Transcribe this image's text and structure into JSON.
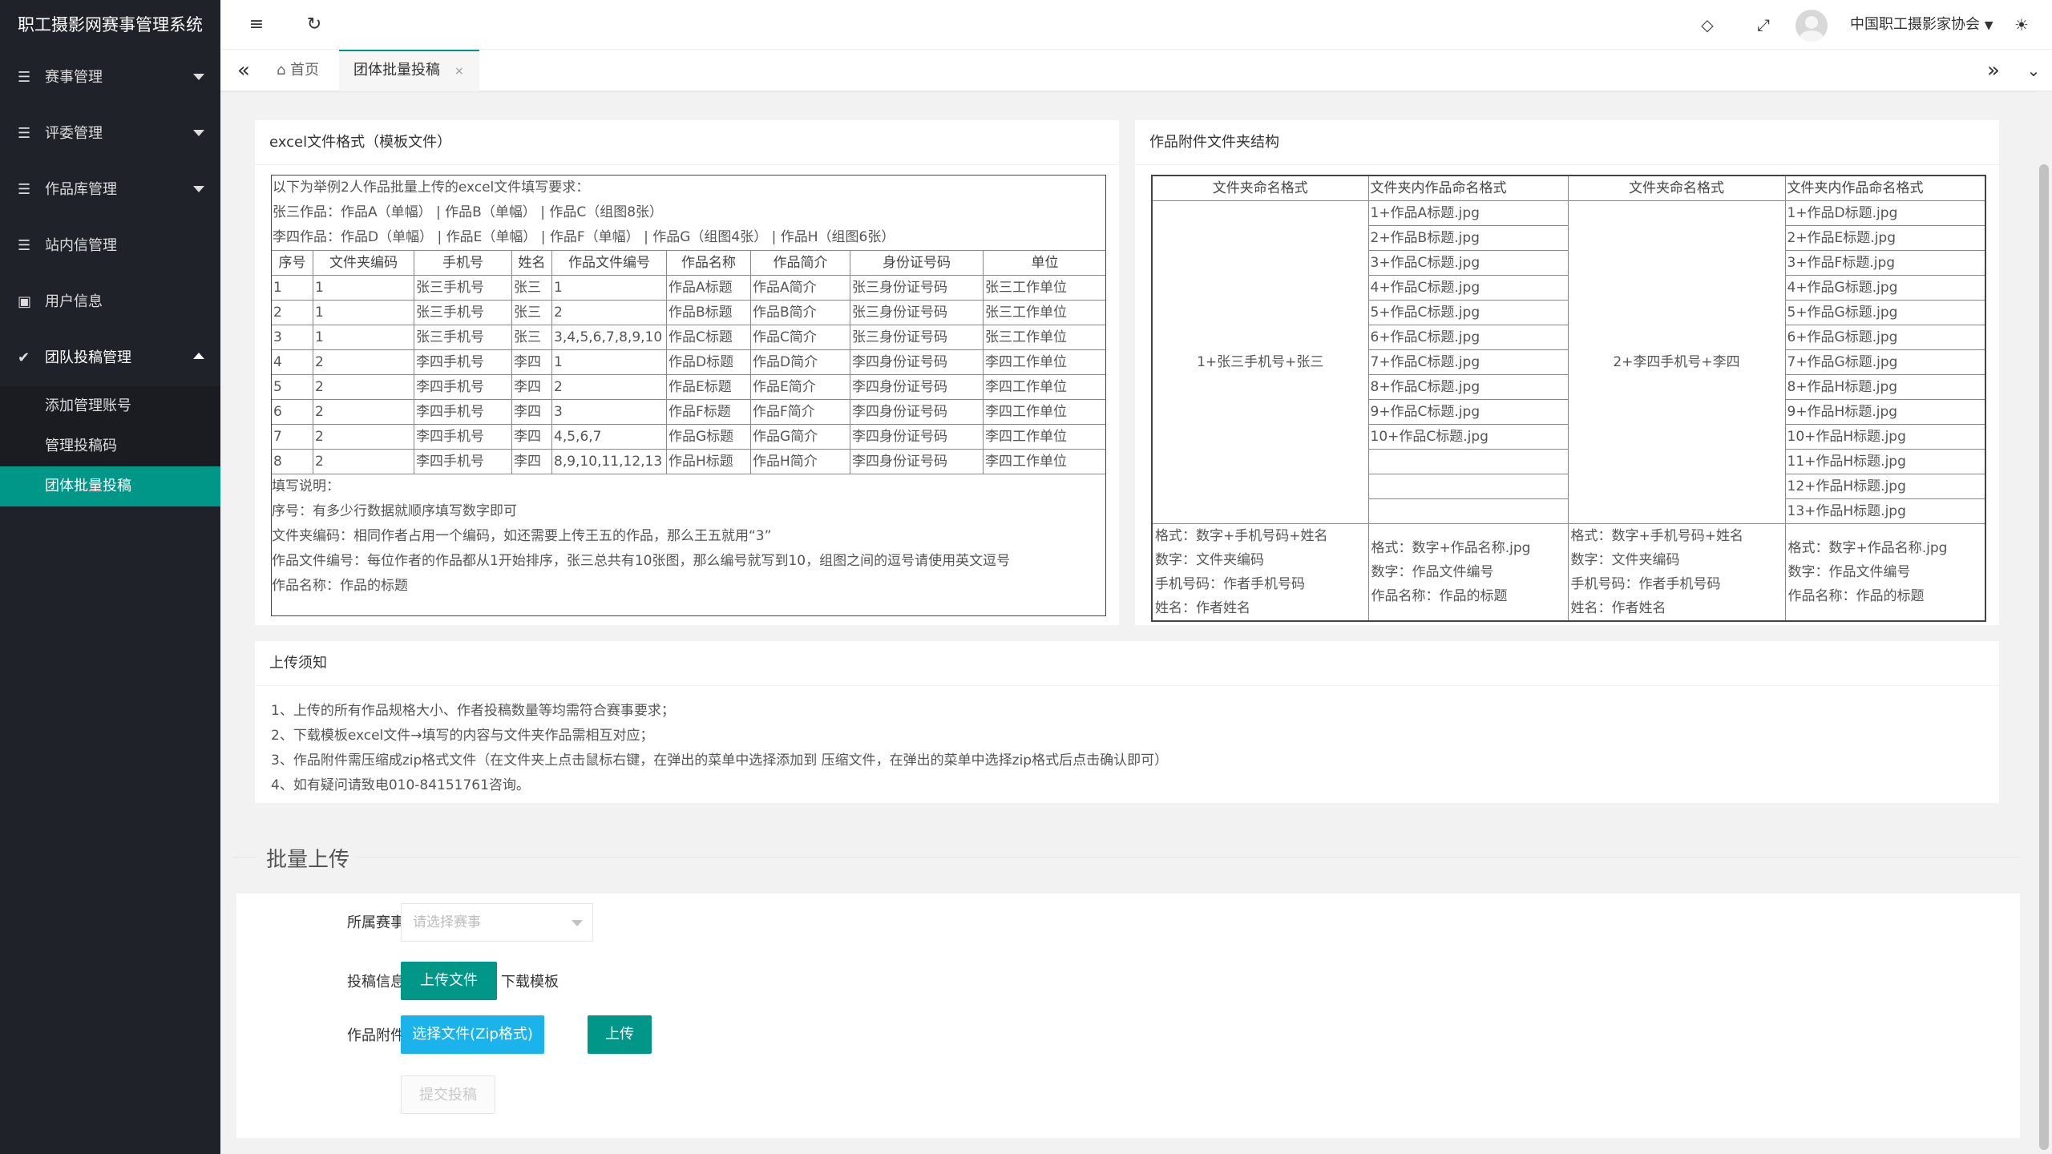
{
  "app": {
    "title": "职工摄影网赛事管理系统"
  },
  "sidebar": {
    "items": [
      {
        "label": "赛事管理"
      },
      {
        "label": "评委管理"
      },
      {
        "label": "作品库管理"
      },
      {
        "label": "站内信管理"
      },
      {
        "label": "用户信息"
      },
      {
        "label": "团队投稿管理"
      }
    ],
    "sub_items": [
      {
        "label": "添加管理账号"
      },
      {
        "label": "管理投稿码"
      },
      {
        "label": "团体批量投稿"
      }
    ]
  },
  "header": {
    "user": "中国职工摄影家协会"
  },
  "tabs": {
    "home": "首页",
    "current": "团体批量投稿",
    "close": "×"
  },
  "excel": {
    "title": "excel文件格式（模板文件）",
    "intro": [
      "以下为举例2人作品批量上传的excel文件填写要求：",
      "张三作品：作品A（单幅） | 作品B（单幅） | 作品C（组图8张）",
      "李四作品：作品D（单幅） | 作品E（单幅） | 作品F（单幅） | 作品G（组图4张） | 作品H（组图6张）"
    ],
    "columns": [
      "序号",
      "文件夹编码",
      "手机号",
      "姓名",
      "作品文件编号",
      "作品名称",
      "作品简介",
      "身份证号码",
      "单位"
    ],
    "rows": [
      [
        "1",
        "1",
        "张三手机号",
        "张三",
        "1",
        "作品A标题",
        "作品A简介",
        "张三身份证号码",
        "张三工作单位"
      ],
      [
        "2",
        "1",
        "张三手机号",
        "张三",
        "2",
        "作品B标题",
        "作品B简介",
        "张三身份证号码",
        "张三工作单位"
      ],
      [
        "3",
        "1",
        "张三手机号",
        "张三",
        "3,4,5,6,7,8,9,10",
        "作品C标题",
        "作品C简介",
        "张三身份证号码",
        "张三工作单位"
      ],
      [
        "4",
        "2",
        "李四手机号",
        "李四",
        "1",
        "作品D标题",
        "作品D简介",
        "李四身份证号码",
        "李四工作单位"
      ],
      [
        "5",
        "2",
        "李四手机号",
        "李四",
        "2",
        "作品E标题",
        "作品E简介",
        "李四身份证号码",
        "李四工作单位"
      ],
      [
        "6",
        "2",
        "李四手机号",
        "李四",
        "3",
        "作品F标题",
        "作品F简介",
        "李四身份证号码",
        "李四工作单位"
      ],
      [
        "7",
        "2",
        "李四手机号",
        "李四",
        "4,5,6,7",
        "作品G标题",
        "作品G简介",
        "李四身份证号码",
        "李四工作单位"
      ],
      [
        "8",
        "2",
        "李四手机号",
        "李四",
        "8,9,10,11,12,13",
        "作品H标题",
        "作品H简介",
        "李四身份证号码",
        "李四工作单位"
      ]
    ],
    "notes": [
      "填写说明：",
      "序号：有多少行数据就顺序填写数字即可",
      "文件夹编码：相同作者占用一个编码，如还需要上传王五的作品，那么王五就用“3”",
      "作品文件编号：每位作者的作品都从1开始排序，张三总共有10张图，那么编号就写到10，组图之间的逗号请使用英文逗号",
      "作品名称：作品的标题"
    ]
  },
  "folder": {
    "title": "作品附件文件夹结构",
    "headers": [
      "文件夹命名格式",
      "文件夹内作品命名格式",
      "文件夹命名格式",
      "文件夹内作品命名格式"
    ],
    "folder1": "1+张三手机号+张三",
    "folder2": "2+李四手机号+李四",
    "files1": [
      "1+作品A标题.jpg",
      "2+作品B标题.jpg",
      "3+作品C标题.jpg",
      "4+作品C标题.jpg",
      "5+作品C标题.jpg",
      "6+作品C标题.jpg",
      "7+作品C标题.jpg",
      "8+作品C标题.jpg",
      "9+作品C标题.jpg",
      "10+作品C标题.jpg",
      "",
      "",
      ""
    ],
    "files2": [
      "1+作品D标题.jpg",
      "2+作品E标题.jpg",
      "3+作品F标题.jpg",
      "4+作品G标题.jpg",
      "5+作品G标题.jpg",
      "6+作品G标题.jpg",
      "7+作品G标题.jpg",
      "8+作品H标题.jpg",
      "9+作品H标题.jpg",
      "10+作品H标题.jpg",
      "11+作品H标题.jpg",
      "12+作品H标题.jpg",
      "13+作品H标题.jpg"
    ],
    "fmt_folder": [
      "格式：数字+手机号码+姓名",
      "数字：文件夹编码",
      "手机号码：作者手机号码",
      "姓名：作者姓名"
    ],
    "fmt_file": [
      "格式：数字+作品名称.jpg",
      "数字：作品文件编号",
      "作品名称：作品的标题"
    ]
  },
  "notice": {
    "title": "上传须知",
    "lines": [
      "1、上传的所有作品规格大小、作者投稿数量等均需符合赛事要求；",
      "2、下载模板excel文件→填写的内容与文件夹作品需相互对应；",
      "3、作品附件需压缩成zip格式文件（在文件夹上点击鼠标右键，在弹出的菜单中选择添加到 压缩文件，在弹出的菜单中选择zip格式后点击确认即可）",
      "4、如有疑问请致电010-84151761咨询。"
    ]
  },
  "upload": {
    "legend": "批量上传",
    "event_label": "所属赛事",
    "event_placeholder": "请选择赛事",
    "info_label": "投稿信息",
    "upload_file": "上传文件",
    "download_template": "下载模板",
    "attach_label": "作品附件",
    "choose_zip": "选择文件(Zip格式)",
    "upload": "上传",
    "submit": "提交投稿"
  }
}
